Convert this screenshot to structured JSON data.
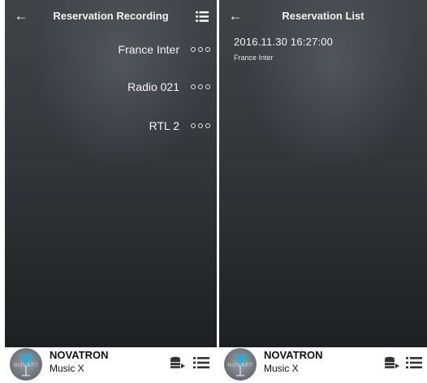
{
  "left_screen": {
    "title": "Reservation Recording",
    "icons": {
      "back": "back-arrow-icon",
      "menu": "list-menu-icon",
      "more": "more-dots-icon"
    },
    "stations": [
      {
        "name": "France Inter"
      },
      {
        "name": "Radio 021"
      },
      {
        "name": "RTL 2"
      }
    ]
  },
  "right_screen": {
    "title": "Reservation List",
    "icons": {
      "back": "back-arrow-icon"
    },
    "reservations": [
      {
        "datetime": "2016.11.30 16:27:00",
        "station": "France Inter"
      }
    ]
  },
  "player": {
    "artist": "NOVATRON",
    "track": "Music X",
    "logo_text": "NOVART",
    "icons": {
      "storage": "storage-icon",
      "playlist": "playlist-icon"
    }
  },
  "colors": {
    "background_top": "#3e4448",
    "background_bottom": "#1d2022",
    "text": "#ffffff",
    "player_bg": "#ffffff"
  }
}
